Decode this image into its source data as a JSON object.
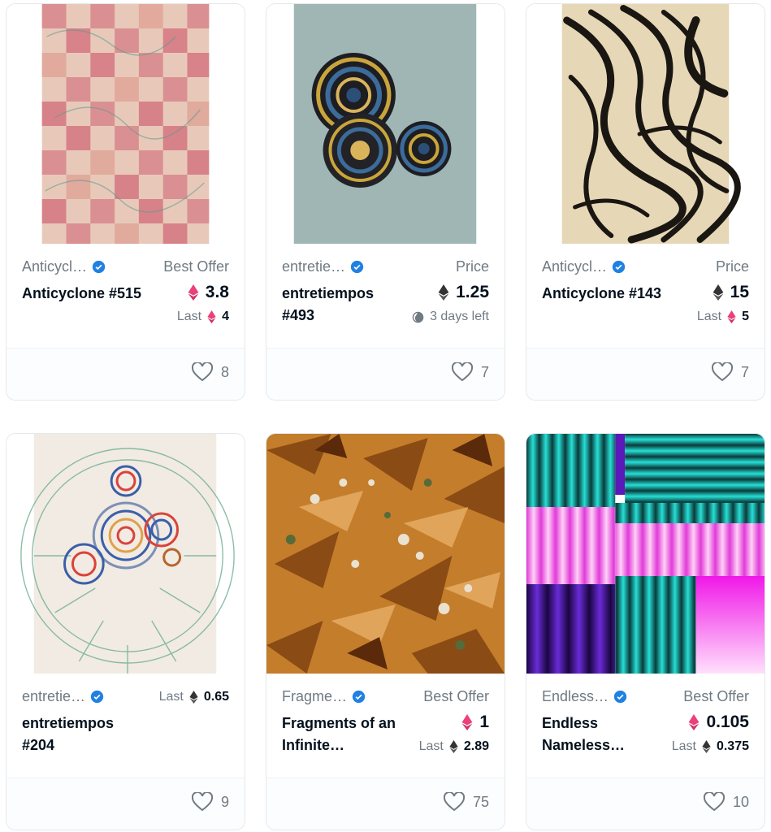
{
  "cards": [
    {
      "collection": "Anticycl…",
      "name": "Anticyclone #515",
      "price_label": "Best Offer",
      "price": "3.8",
      "price_currency": "weth",
      "sub_label": "Last",
      "sub_value": "4",
      "sub_currency": "weth",
      "favorites": "8"
    },
    {
      "collection": "entretie…",
      "name": "entretiempos #493",
      "price_label": "Price",
      "price": "1.25",
      "price_currency": "eth",
      "sub_label": "3 days left",
      "sub_icon": "clock-icon",
      "favorites": "7"
    },
    {
      "collection": "Anticycl…",
      "name": "Anticyclone #143",
      "price_label": "Price",
      "price": "15",
      "price_currency": "eth",
      "sub_label": "Last",
      "sub_value": "5",
      "sub_currency": "weth",
      "favorites": "7"
    },
    {
      "collection": "entretie…",
      "name": "entretiempos #204",
      "price_label": "Last",
      "price_label_value": "0.65",
      "favorites": "9"
    },
    {
      "collection": "Fragme…",
      "name": "Fragments of an Infinite…",
      "price_label": "Best Offer",
      "price": "1",
      "price_currency": "weth",
      "sub_label": "Last",
      "sub_value": "2.89",
      "sub_currency": "eth",
      "favorites": "75"
    },
    {
      "collection": "Endless…",
      "name": "Endless Nameless…",
      "price_label": "Best Offer",
      "price": "0.105",
      "price_currency": "weth",
      "sub_label": "Last",
      "sub_value": "0.375",
      "sub_currency": "eth",
      "favorites": "10"
    }
  ],
  "colors": {
    "verified": "#2081e2",
    "eth": "#343434",
    "weth": "#ec407a",
    "muted": "#707a83",
    "text": "#04111d"
  }
}
